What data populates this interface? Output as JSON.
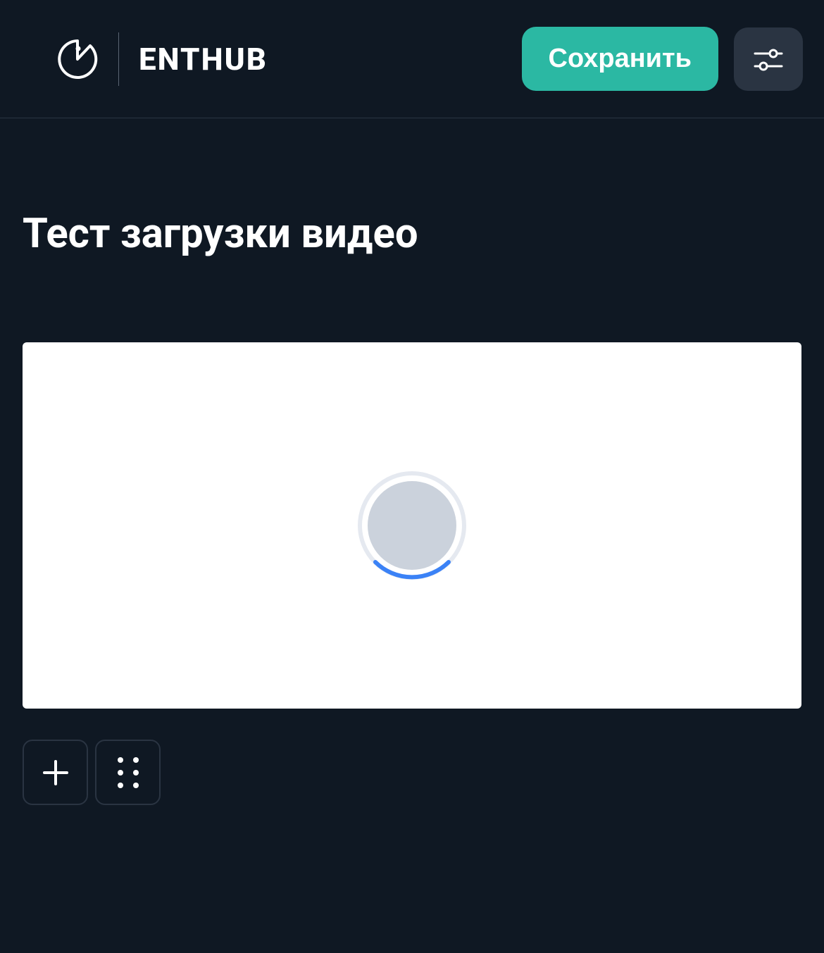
{
  "header": {
    "brand_name": "ENTHUB",
    "save_label": "Сохранить"
  },
  "main": {
    "page_title": "Тест загрузки видео"
  },
  "colors": {
    "background": "#0f1823",
    "accent": "#2bb8a3",
    "card": "#ffffff",
    "secondary_bg": "#2a3442",
    "spinner_track": "#e5e9f0",
    "spinner_progress": "#3b82f6",
    "spinner_fill": "#cbd2dc"
  }
}
